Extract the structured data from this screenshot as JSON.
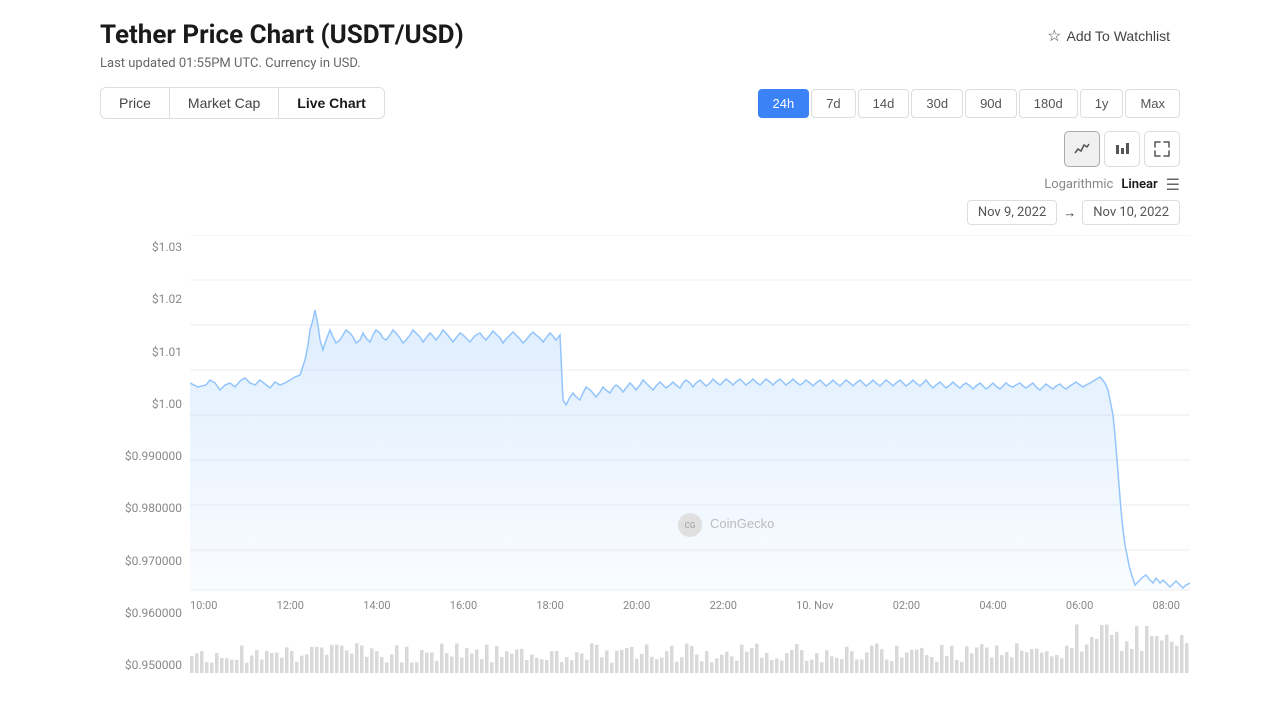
{
  "page": {
    "title": "Tether Price Chart (USDT/USD)",
    "subtitle": "Last updated 01:55PM UTC. Currency in USD.",
    "watchlist_label": "Add To Watchlist"
  },
  "tabs": [
    {
      "label": "Price",
      "active": false
    },
    {
      "label": "Market Cap",
      "active": false
    },
    {
      "label": "Live Chart",
      "active": true
    }
  ],
  "time_buttons": [
    {
      "label": "24h",
      "active": true
    },
    {
      "label": "7d",
      "active": false
    },
    {
      "label": "14d",
      "active": false
    },
    {
      "label": "30d",
      "active": false
    },
    {
      "label": "90d",
      "active": false
    },
    {
      "label": "180d",
      "active": false
    },
    {
      "label": "1y",
      "active": false
    },
    {
      "label": "Max",
      "active": false
    }
  ],
  "scale": {
    "logarithmic": "Logarithmic",
    "linear": "Linear",
    "active": "linear"
  },
  "date_range": {
    "from": "Nov 9, 2022",
    "arrow": "→",
    "to": "Nov 10, 2022"
  },
  "y_axis_labels": [
    "$1.03",
    "$1.02",
    "$1.01",
    "$1.00",
    "$0.990000",
    "$0.980000",
    "$0.970000",
    "$0.960000",
    "$0.950000"
  ],
  "x_axis_labels": [
    "10:00",
    "12:00",
    "14:00",
    "16:00",
    "18:00",
    "20:00",
    "22:00",
    "10. Nov",
    "02:00",
    "04:00",
    "06:00",
    "08:00"
  ],
  "coingecko_label": "CoinGecko",
  "chart_icons": {
    "line": "📈",
    "bar": "📊",
    "fullscreen": "⛶"
  }
}
